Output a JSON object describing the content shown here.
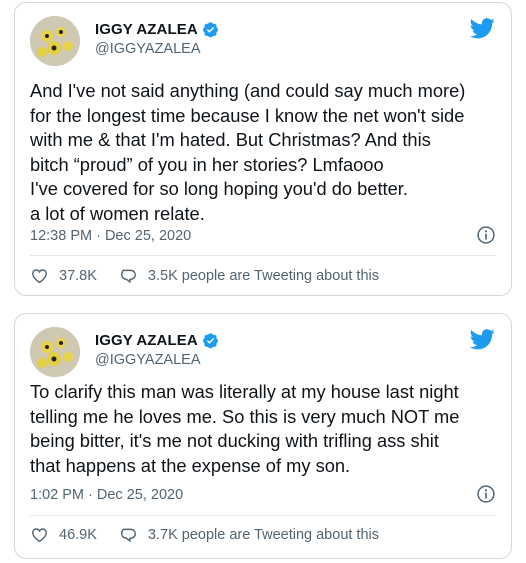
{
  "tweets": [
    {
      "display_name": "IGGY AZALEA",
      "handle": "@IGGYAZALEA",
      "text": "And I've not said anything (and could say much more)\nfor the longest time because I know the net won't side\nwith me & that I'm hated.  But Christmas? And this\nbitch “proud” of you in her stories? Lmfaooo\nI've covered for so long hoping you'd do better.\na lot of women relate.",
      "timestamp": "12:38 PM · Dec 25, 2020",
      "likes": "37.8K",
      "tweeting_about": "3.5K people are Tweeting about this"
    },
    {
      "display_name": "IGGY AZALEA",
      "handle": "@IGGYAZALEA",
      "text": "To clarify this man was literally at my house last night\ntelling me he loves me. So this is very much NOT me\nbeing bitter, it's me not ducking with trifling ass shit\nthat happens at the expense of my son.",
      "timestamp": "1:02 PM · Dec 25, 2020",
      "likes": "46.9K",
      "tweeting_about": "3.7K people are Tweeting about this"
    }
  ],
  "icons": {
    "verified": "verified-badge-icon",
    "brand": "twitter-bird-icon",
    "info": "info-icon",
    "like": "heart-icon",
    "conversation": "speech-bubble-icon"
  },
  "colors": {
    "brand_blue": "#1d9bf0",
    "text": "#0f1419",
    "muted": "#536471",
    "border": "#cfd9de"
  }
}
